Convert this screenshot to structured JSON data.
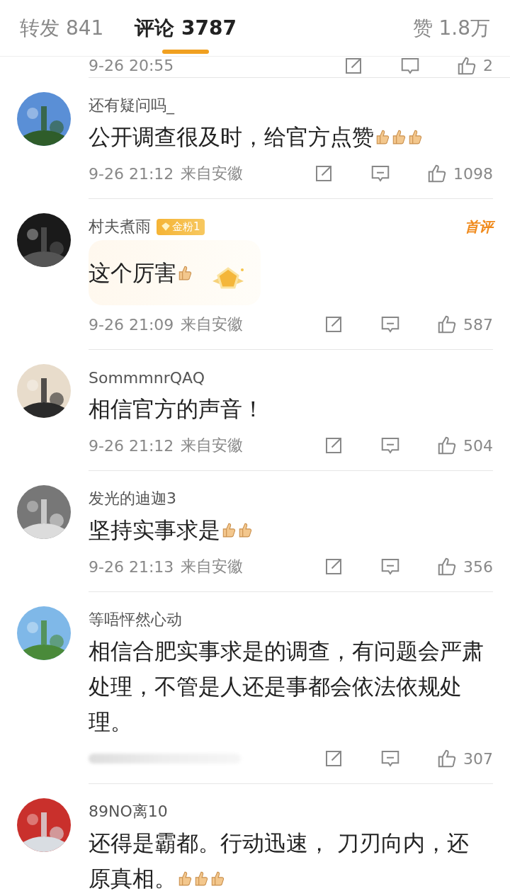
{
  "tabs": [
    {
      "label": "转发 841",
      "selected": false
    },
    {
      "label": "评论 3787",
      "selected": true
    }
  ],
  "likes_total": "赞 1.8万",
  "previous_comment": {
    "time": "9-26 20:55",
    "likes": "2"
  },
  "comments": [
    {
      "user": "还有疑问吗_",
      "highlight": false,
      "text": "公开调查很及时，给官方点赞",
      "emojis": [
        {
          "kind": "thumb"
        },
        {
          "kind": "thumb"
        },
        {
          "kind": "thumb"
        }
      ],
      "meta": {
        "kind": "plain",
        "time": "9-26 21:12",
        "location": "来自安徽"
      },
      "likes": "1098"
    },
    {
      "user": "村夫煮雨",
      "badge": "金粉1",
      "tag": "首评",
      "highlight": true,
      "text": "这个厉害",
      "emojis": [
        {
          "kind": "thumb"
        }
      ],
      "meta": {
        "kind": "plain",
        "time": "9-26 21:09",
        "location": "来自安徽"
      },
      "likes": "587"
    },
    {
      "user": "SommmnrQAQ",
      "highlight": false,
      "text": "相信官方的声音！",
      "meta": {
        "kind": "plain",
        "time": "9-26 21:12",
        "location": "来自安徽"
      },
      "likes": "504"
    },
    {
      "user": "发光的迪迦3",
      "highlight": false,
      "text": "坚持实事求是",
      "emojis": [
        {
          "kind": "thumb"
        },
        {
          "kind": "thumb"
        }
      ],
      "meta": {
        "kind": "plain",
        "time": "9-26 21:13",
        "location": "来自安徽"
      },
      "likes": "356"
    },
    {
      "user": "等唔怦然心动",
      "highlight": false,
      "text": "相信合肥实事求是的调查，有问题会严肃处理，不管是人还是事都会依法依规处理。",
      "meta": {
        "kind": "blurred"
      },
      "likes": "307"
    },
    {
      "user": "89NO离10",
      "highlight": false,
      "text": "还得是霸都。行动迅速， 刀刃向内，还原真相。",
      "emojis": [
        {
          "kind": "thumb"
        },
        {
          "kind": "thumb"
        },
        {
          "kind": "thumb"
        }
      ]
    }
  ]
}
